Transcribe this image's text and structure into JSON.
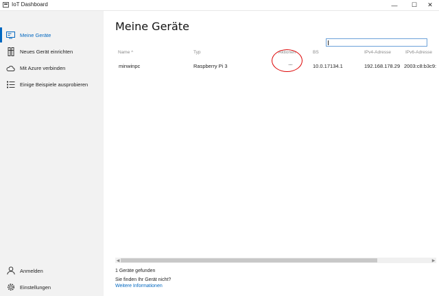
{
  "window": {
    "title": "IoT Dashboard",
    "minimize": "—",
    "maximize": "☐",
    "close": "✕"
  },
  "sidebar": {
    "items": [
      {
        "label": "Meine Geräte",
        "icon": "devices-icon",
        "active": true
      },
      {
        "label": "Neues Gerät einrichten",
        "icon": "setup-icon"
      },
      {
        "label": "Mit Azure verbinden",
        "icon": "cloud-icon"
      },
      {
        "label": "Einige Beispiele ausprobieren",
        "icon": "list-icon"
      }
    ],
    "bottom": [
      {
        "label": "Anmelden",
        "icon": "person-icon"
      },
      {
        "label": "Einstellungen",
        "icon": "gear-icon"
      }
    ]
  },
  "main": {
    "title": "Meine Geräte",
    "search": {
      "value": "",
      "placeholder": ""
    },
    "columns": {
      "name": "Name",
      "name_sort": "^",
      "type": "Typ",
      "actions": "Aktionen",
      "os": "BS",
      "ipv4": "IPv4-Adresse",
      "ipv6": "IPv6-Adresse"
    },
    "rows": [
      {
        "name": "minwinpc",
        "type": "Raspberry Pi 3",
        "actions": "···",
        "os": "10.0.17134.1",
        "ipv4": "192.168.178.29",
        "ipv6": "2003:c8:b3c9:"
      }
    ],
    "footer": {
      "count": "1 Geräte gefunden",
      "question": "Sie finden Ihr Gerät nicht?",
      "link": "Weitere Informationen"
    }
  },
  "colors": {
    "accent": "#0067c0",
    "sidebar_bg": "#f2f2f2",
    "annotation": "#dd0000"
  }
}
